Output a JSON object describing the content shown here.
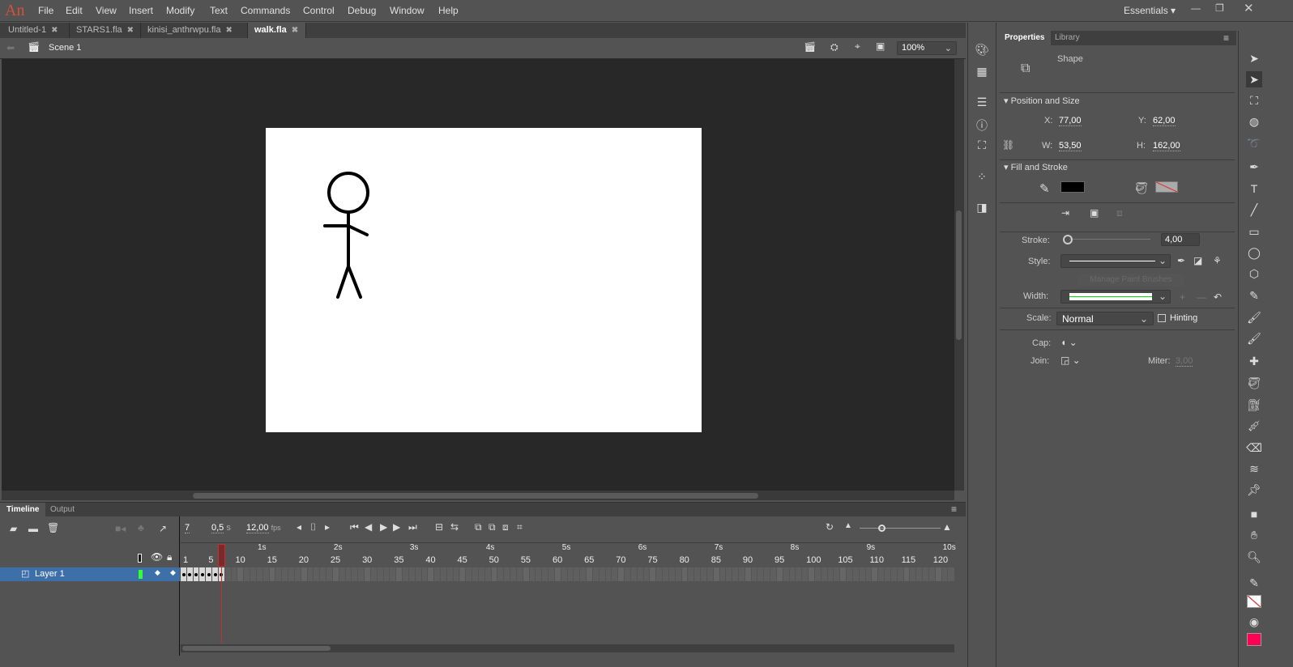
{
  "app": {
    "logo": "An",
    "workspace": "Essentials"
  },
  "menu": [
    "File",
    "Edit",
    "View",
    "Insert",
    "Modify",
    "Text",
    "Commands",
    "Control",
    "Debug",
    "Window",
    "Help"
  ],
  "doc_tabs": [
    {
      "label": "Untitled-1",
      "active": false
    },
    {
      "label": "STARS1.fla",
      "active": false
    },
    {
      "label": "kinisi_anthrwpu.fla",
      "active": false
    },
    {
      "label": "walk.fla",
      "active": true
    }
  ],
  "scene": {
    "label": "Scene 1",
    "zoom": "100%"
  },
  "properties": {
    "tabs": [
      "Properties",
      "Library"
    ],
    "object_type": "Shape",
    "position_size": {
      "header": "Position and Size",
      "x_label": "X:",
      "x": "77,00",
      "y_label": "Y:",
      "y": "62,00",
      "w_label": "W:",
      "w": "53,50",
      "h_label": "H:",
      "h": "162,00"
    },
    "fill_stroke": {
      "header": "Fill and Stroke",
      "stroke_color": "#000000",
      "fill_color": "none"
    },
    "stroke_label": "Stroke:",
    "stroke_value": "4,00",
    "style_label": "Style:",
    "manage_brushes": "Manage Paint Brushes",
    "width_label": "Width:",
    "scale_label": "Scale:",
    "scale_value": "Normal",
    "hinting_label": "Hinting",
    "hinting_checked": false,
    "cap_label": "Cap:",
    "join_label": "Join:",
    "miter_label": "Miter:",
    "miter_value": "3,00"
  },
  "timeline": {
    "tabs": [
      "Timeline",
      "Output"
    ],
    "current_frame": "7",
    "time": "0,5",
    "time_unit": "s",
    "fps": "12,00",
    "fps_unit": "fps",
    "layers": [
      {
        "name": "Layer 1",
        "color": "#33ff33"
      }
    ],
    "frame_labels": [
      1,
      5,
      10,
      15,
      20,
      25,
      30,
      35,
      40,
      45,
      50,
      55,
      60,
      65,
      70,
      75,
      80,
      85,
      90,
      95,
      100,
      105,
      110,
      115,
      120
    ],
    "second_labels": [
      "1s",
      "2s",
      "3s",
      "4s",
      "5s",
      "6s",
      "7s",
      "8s",
      "9s",
      "10s"
    ],
    "keyframes": 7,
    "playhead_frame": 7
  },
  "colors": {
    "accent": "#d4513a",
    "selection": "#3d6fa8",
    "tool_fill": "#ff0055"
  }
}
